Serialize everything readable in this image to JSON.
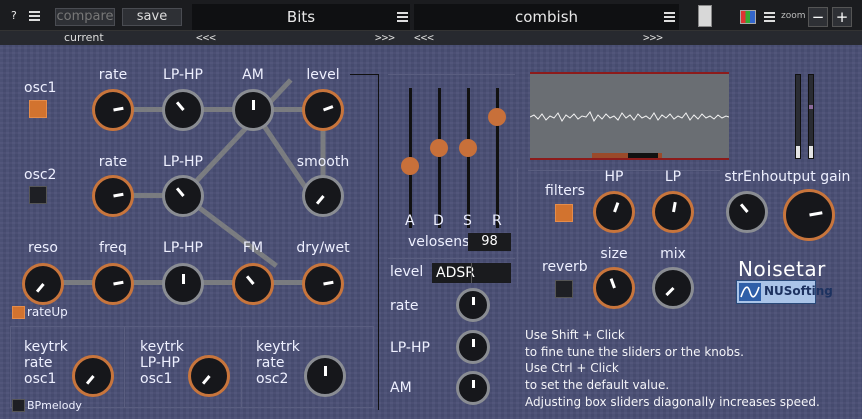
{
  "topbar": {
    "help_label": "?",
    "compare_label": "compare",
    "save_label": "save",
    "preset_a": "Bits",
    "preset_b": "combish",
    "zoom_label": "zoom",
    "zoom_minus": "−",
    "zoom_plus": "+",
    "current_label": "current",
    "prev_arrows": "<<<",
    "next_arrows": ">>>"
  },
  "osc": {
    "osc1_label": "osc1",
    "osc2_label": "osc2",
    "reso_label": "reso",
    "rateup_label": "rateUp",
    "bpmelody_label": "BPmelody"
  },
  "grid": {
    "row1": [
      "rate",
      "LP-HP",
      "AM",
      "level"
    ],
    "row2": [
      "rate",
      "LP-HP",
      "smooth"
    ],
    "row3": [
      "freq",
      "LP-HP",
      "FM",
      "dry/wet"
    ]
  },
  "keytrk": [
    {
      "l1": "keytrk",
      "l2": "rate",
      "l3": "osc1"
    },
    {
      "l1": "keytrk",
      "l2": "LP-HP",
      "l3": "osc1"
    },
    {
      "l1": "keytrk",
      "l2": "rate",
      "l3": "osc2"
    }
  ],
  "env": {
    "a": "A",
    "d": "D",
    "s": "S",
    "r": "R",
    "velosens_label": "velosens",
    "velosens_value": "98",
    "level_label": "level",
    "level_value": "ADSR",
    "rate_label": "rate",
    "lphp_label": "LP-HP",
    "am_label": "AM"
  },
  "fx": {
    "filters_label": "filters",
    "hp_label": "HP",
    "lp_label": "LP",
    "reverb_label": "reverb",
    "size_label": "size",
    "mix_label": "mix",
    "strenh_label": "strEnh",
    "gain_label": "output gain"
  },
  "brand": {
    "name": "Noisetar",
    "maker": "NUSofting"
  },
  "help": {
    "line1": "Use Shift + Click",
    "line2": "to fine tune the sliders or the knobs.",
    "line3": "Use Ctrl + Click",
    "line4": "to set the default value.",
    "line5": "Adjusting box sliders diagonally increases speed."
  },
  "colors": {
    "panel": "#4a4f75",
    "accent_orange": "#c8703a",
    "scope_border": "#8c1b1b"
  }
}
